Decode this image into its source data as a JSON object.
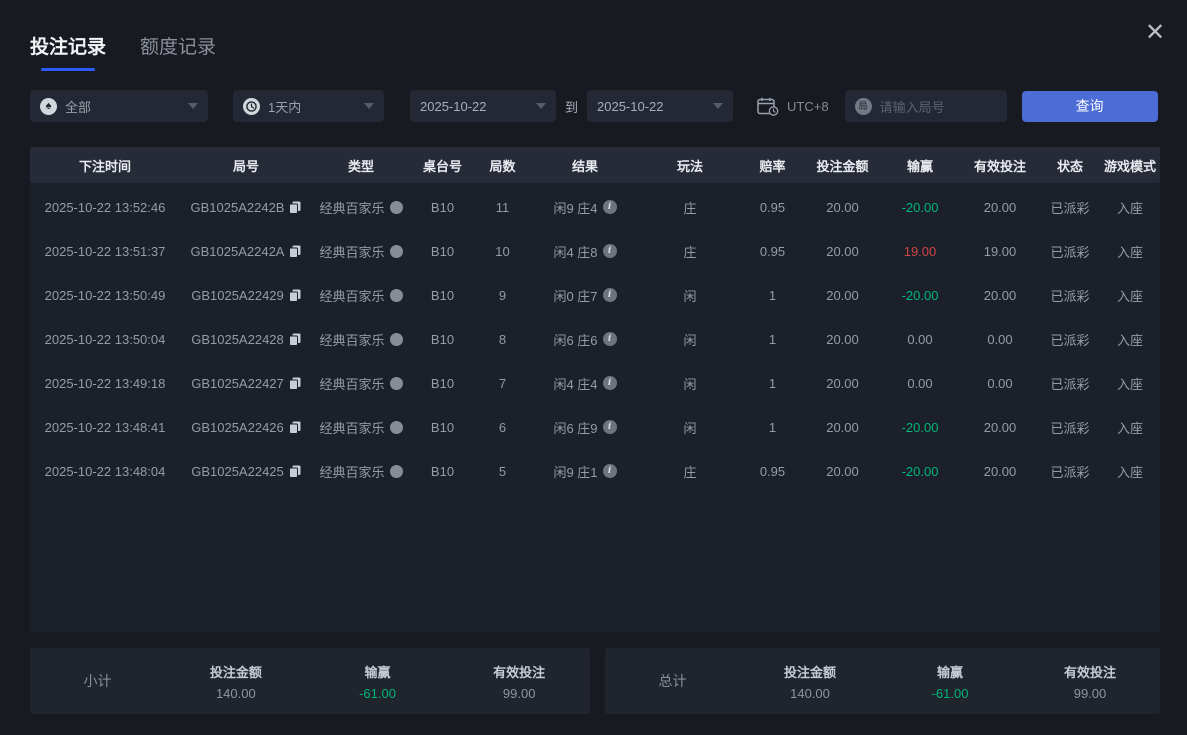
{
  "window": {
    "close_icon": "✕"
  },
  "tabs": [
    {
      "label": "投注记录",
      "active": true
    },
    {
      "label": "额度记录",
      "active": false
    }
  ],
  "filters": {
    "game_type": {
      "value": "全部",
      "icon": "spade"
    },
    "time_range": {
      "value": "1天内",
      "icon": "clock"
    },
    "date_from": "2025-10-22",
    "to_label": "到",
    "date_to": "2025-10-22",
    "timezone": "UTC+8",
    "round_input": {
      "placeholder": "请输入局号",
      "value": "",
      "icon_char": "局"
    },
    "query_button": "查询"
  },
  "table": {
    "headers": [
      "下注时间",
      "局号",
      "类型",
      "桌台号",
      "局数",
      "结果",
      "玩法",
      "赔率",
      "投注金额",
      "输赢",
      "有效投注",
      "状态",
      "游戏模式"
    ],
    "rows": [
      {
        "time": "2025-10-22 13:52:46",
        "round_id": "GB1025A2242B",
        "type": "经典百家乐",
        "table_no": "B10",
        "round_no": "11",
        "result": "闲9 庄4",
        "play": "庄",
        "odds": "0.95",
        "bet": "20.00",
        "win_loss": "-20.00",
        "win_loss_color": "green",
        "valid_bet": "20.00",
        "status": "已派彩",
        "mode": "入座"
      },
      {
        "time": "2025-10-22 13:51:37",
        "round_id": "GB1025A2242A",
        "type": "经典百家乐",
        "table_no": "B10",
        "round_no": "10",
        "result": "闲4 庄8",
        "play": "庄",
        "odds": "0.95",
        "bet": "20.00",
        "win_loss": "19.00",
        "win_loss_color": "red",
        "valid_bet": "19.00",
        "status": "已派彩",
        "mode": "入座"
      },
      {
        "time": "2025-10-22 13:50:49",
        "round_id": "GB1025A22429",
        "type": "经典百家乐",
        "table_no": "B10",
        "round_no": "9",
        "result": "闲0 庄7",
        "play": "闲",
        "odds": "1",
        "bet": "20.00",
        "win_loss": "-20.00",
        "win_loss_color": "green",
        "valid_bet": "20.00",
        "status": "已派彩",
        "mode": "入座"
      },
      {
        "time": "2025-10-22 13:50:04",
        "round_id": "GB1025A22428",
        "type": "经典百家乐",
        "table_no": "B10",
        "round_no": "8",
        "result": "闲6 庄6",
        "play": "闲",
        "odds": "1",
        "bet": "20.00",
        "win_loss": "0.00",
        "win_loss_color": "",
        "valid_bet": "0.00",
        "status": "已派彩",
        "mode": "入座"
      },
      {
        "time": "2025-10-22 13:49:18",
        "round_id": "GB1025A22427",
        "type": "经典百家乐",
        "table_no": "B10",
        "round_no": "7",
        "result": "闲4 庄4",
        "play": "闲",
        "odds": "1",
        "bet": "20.00",
        "win_loss": "0.00",
        "win_loss_color": "",
        "valid_bet": "0.00",
        "status": "已派彩",
        "mode": "入座"
      },
      {
        "time": "2025-10-22 13:48:41",
        "round_id": "GB1025A22426",
        "type": "经典百家乐",
        "table_no": "B10",
        "round_no": "6",
        "result": "闲6 庄9",
        "play": "闲",
        "odds": "1",
        "bet": "20.00",
        "win_loss": "-20.00",
        "win_loss_color": "green",
        "valid_bet": "20.00",
        "status": "已派彩",
        "mode": "入座"
      },
      {
        "time": "2025-10-22 13:48:04",
        "round_id": "GB1025A22425",
        "type": "经典百家乐",
        "table_no": "B10",
        "round_no": "5",
        "result": "闲9 庄1",
        "play": "庄",
        "odds": "0.95",
        "bet": "20.00",
        "win_loss": "-20.00",
        "win_loss_color": "green",
        "valid_bet": "20.00",
        "status": "已派彩",
        "mode": "入座"
      }
    ]
  },
  "summary": {
    "subtotal": {
      "label": "小计",
      "stats": [
        {
          "label": "投注金额",
          "value": "140.00",
          "color": ""
        },
        {
          "label": "输赢",
          "value": "-61.00",
          "color": "green"
        },
        {
          "label": "有效投注",
          "value": "99.00",
          "color": ""
        }
      ]
    },
    "total": {
      "label": "总计",
      "stats": [
        {
          "label": "投注金额",
          "value": "140.00",
          "color": ""
        },
        {
          "label": "输赢",
          "value": "-61.00",
          "color": "green"
        },
        {
          "label": "有效投注",
          "value": "99.00",
          "color": ""
        }
      ]
    }
  },
  "colors": {
    "accent_blue": "#4c6cd6",
    "tab_underline": "#2e5bf7",
    "loss_green": "#00b576",
    "win_red": "#cf4747"
  }
}
